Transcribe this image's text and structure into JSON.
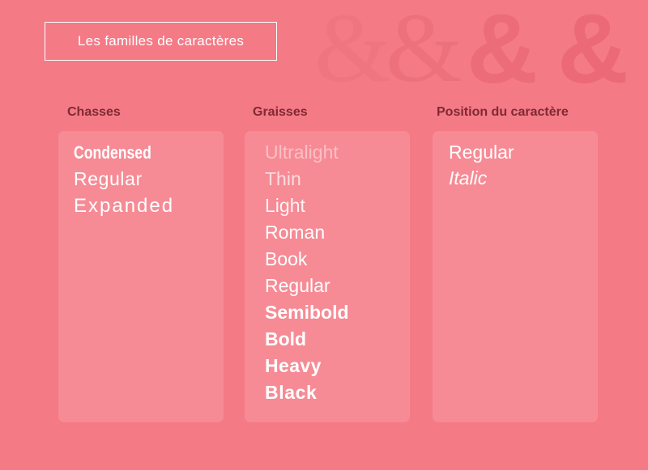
{
  "decoration": {
    "ampersands": [
      "&",
      "&",
      "&",
      "&"
    ]
  },
  "header": {
    "title": "Les familles de caractères"
  },
  "columns": [
    {
      "heading": "Chasses",
      "items": [
        "Condensed",
        "Regular",
        "Expanded"
      ]
    },
    {
      "heading": "Graisses",
      "items": [
        "Ultralight",
        "Thin",
        "Light",
        "Roman",
        "Book",
        "Regular",
        "Semibold",
        "Bold",
        "Heavy",
        "Black"
      ]
    },
    {
      "heading": "Position du caractère",
      "items": [
        "Regular",
        "Italic"
      ]
    }
  ],
  "colors": {
    "background": "#f47a86",
    "panel": "#f68b95",
    "heading": "#7e2a33",
    "text": "#ffffff"
  }
}
